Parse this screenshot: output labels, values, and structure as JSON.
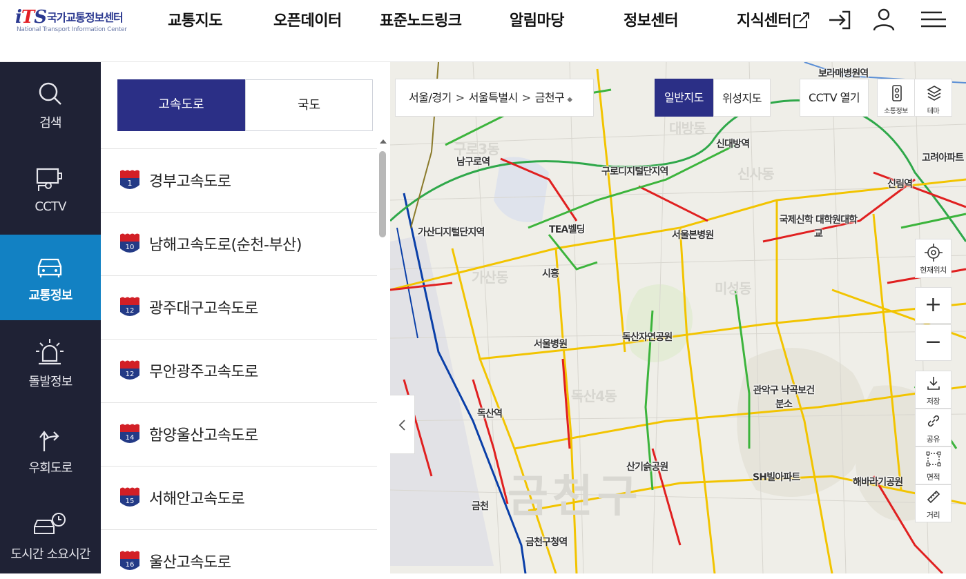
{
  "header": {
    "logo_mark": "iTS",
    "logo_name": "국가교통정보센터",
    "logo_sub": "National Transport Information Center",
    "nav": [
      "교통지도",
      "오픈데이터",
      "표준노드링크",
      "알림마당",
      "정보센터",
      "지식센터"
    ],
    "icons": [
      "external-link-icon",
      "login-icon",
      "user-icon",
      "menu-icon"
    ]
  },
  "sidebar": {
    "items": [
      {
        "label": "검색",
        "icon": "search-icon"
      },
      {
        "label": "CCTV",
        "icon": "cctv-icon"
      },
      {
        "label": "교통정보",
        "icon": "car-icon",
        "active": true
      },
      {
        "label": "돌발정보",
        "icon": "alert-siren-icon"
      },
      {
        "label": "우회도로",
        "icon": "detour-icon"
      },
      {
        "label": "도시간 소요시간",
        "icon": "car-clock-icon"
      }
    ]
  },
  "panel": {
    "tabs": [
      {
        "label": "고속도로",
        "active": true
      },
      {
        "label": "국도",
        "active": false
      }
    ],
    "roads": [
      {
        "number": "1",
        "name": "경부고속도로"
      },
      {
        "number": "10",
        "name": "남해고속도로(순천-부산)"
      },
      {
        "number": "12",
        "name": "광주대구고속도로"
      },
      {
        "number": "12",
        "name": "무안광주고속도로"
      },
      {
        "number": "14",
        "name": "함양울산고속도로"
      },
      {
        "number": "15",
        "name": "서해안고속도로"
      },
      {
        "number": "16",
        "name": "울산고속도로"
      }
    ]
  },
  "map": {
    "breadcrumb": [
      "서울/경기",
      "서울특별시",
      "금천구"
    ],
    "map_types": [
      {
        "label": "일반지도",
        "active": true
      },
      {
        "label": "위성지도",
        "active": false
      }
    ],
    "cctv_button": "CCTV 열기",
    "top_tools": [
      {
        "label": "소통정보",
        "icon": "traffic-info-icon"
      },
      {
        "label": "테마",
        "icon": "layers-icon"
      }
    ],
    "side_tools": {
      "location": "현재위치",
      "zoom_in": "+",
      "zoom_out": "−",
      "save": "저장",
      "share": "공유",
      "area": "면적",
      "distance": "거리"
    },
    "place_labels": [
      "보라매병원역",
      "신대방역",
      "구로디지털단지역",
      "남구로역",
      "가산디지털단지역",
      "신림역",
      "TEA벨딩",
      "서울본병원",
      "국제신학 대학원대학교",
      "시흥",
      "서울병원",
      "독산자연공원",
      "관악구 낙곡보건분소",
      "독산역",
      "산기슭공원",
      "SH빌아파트",
      "해바라기공원",
      "금천",
      "금천구청역",
      "고려아파트"
    ],
    "district_labels": [
      "금천구",
      "가산동",
      "독산4동",
      "미성동",
      "신사동",
      "대방동",
      "구로3동"
    ],
    "colors": {
      "congested": "#e02020",
      "slow": "#f2c400",
      "smooth": "#3cb43c",
      "subway_line1": "#0a3fa8",
      "accent": "#2b2f86",
      "sidebar": "#1f2235",
      "sidebar_active": "#1281c3"
    }
  }
}
